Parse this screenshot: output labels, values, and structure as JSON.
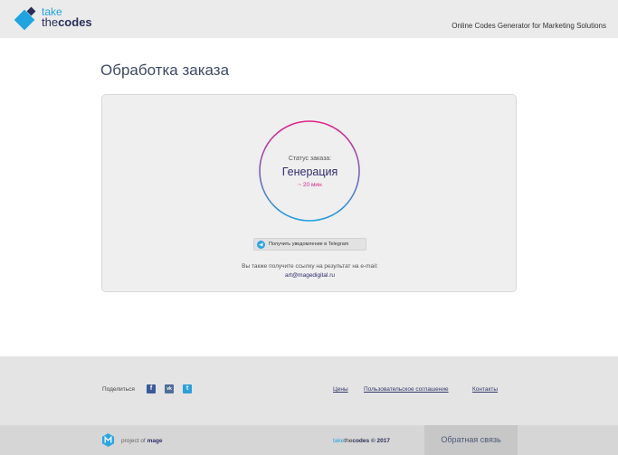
{
  "header": {
    "logo_take": "take",
    "logo_the": "the",
    "logo_codes": "codes",
    "tagline": "Online Codes Generator for Marketing Solutions",
    "brand_color": "#1fa4e0"
  },
  "main": {
    "title": "Обработка заказа",
    "status": {
      "label": "Статус заказа:",
      "value": "Генерация",
      "eta": "~ 20 мин",
      "ring_gradient": [
        "#e0238a",
        "#1f9fe0"
      ]
    },
    "telegram_button": "Получить уведомление в Telegram",
    "email_note": "Вы также получите ссылку на результат на e-mail:",
    "email": "art@magedigital.ru"
  },
  "footer": {
    "share_label": "Поделиться",
    "social": [
      {
        "icon": "facebook-icon",
        "glyph": "f"
      },
      {
        "icon": "vk-icon",
        "glyph": "vk"
      },
      {
        "icon": "twitter-icon",
        "glyph": "t"
      }
    ],
    "links": {
      "prices": "Цены",
      "terms": "Пользовательское соглашение",
      "contacts": "Контакты"
    },
    "project_of": "project of",
    "mage": "mage",
    "copyright_take": "take",
    "copyright_the": "the",
    "copyright_codes": "codes",
    "copyright_year": "© 2017",
    "feedback": "Обратная связь"
  }
}
